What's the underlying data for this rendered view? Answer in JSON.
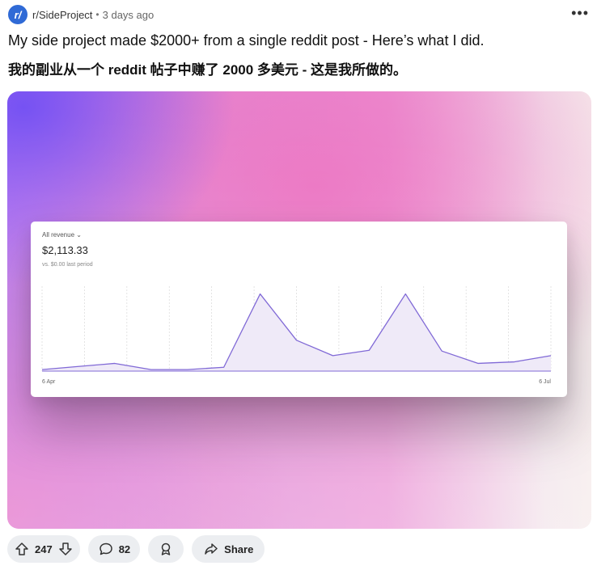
{
  "post": {
    "subreddit_icon": "r/",
    "subreddit": "r/SideProject",
    "separator": "•",
    "age": "3 days ago",
    "more_icon": "•••",
    "title": "My side project made $2000+ from a single reddit post - Here’s what I did.",
    "title_translation": "我的副业从一个 reddit 帖子中赚了 2000 多美元 - 这是我所做的。"
  },
  "revenue_card": {
    "label": "All revenue ⌄",
    "value": "$2,113.33",
    "comparison": "vs. $0.00 last period"
  },
  "chart_data": {
    "type": "area",
    "x_start_label": "6 Apr",
    "x_end_label": "6 Jul",
    "values": [
      2,
      6,
      10,
      2,
      2,
      5,
      100,
      40,
      20,
      27,
      100,
      26,
      10,
      12,
      20
    ],
    "ylim": [
      0,
      110
    ],
    "grid": "vertical",
    "colors": {
      "line": "#8069d6",
      "fill": "#efeaf8",
      "grid": "#d8d8d8"
    }
  },
  "actions": {
    "upvote_icon": "arrow-up-icon",
    "score": "247",
    "downvote_icon": "arrow-down-icon",
    "comments_icon": "comment-icon",
    "comments": "82",
    "award_icon": "award-icon",
    "share_icon": "share-icon",
    "share_label": "Share"
  }
}
